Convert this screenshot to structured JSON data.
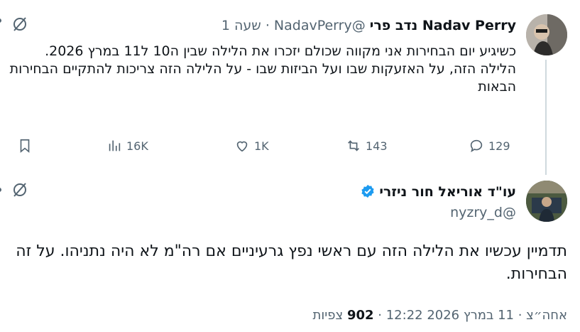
{
  "reply": {
    "display_name": "Nadav Perry נדב פרי",
    "handle": "@NadavPerry",
    "time": "שעה 1",
    "text": "כשיגיע יום הבחירות אני מקווה שכולם יזכרו את הלילה שבין ה10 ל11 במרץ 2026.\nהלילה הזה, על האזעקות שבו ועל הביזות שבו - על הלילה הזה צריכות להתקיים הבחירות הבאות",
    "stats": {
      "replies": "129",
      "retweets": "143",
      "likes": "1K",
      "views": "16K"
    }
  },
  "main": {
    "display_name": "עו\"ד אוריאל חור ניזרי",
    "handle": "@nyzry_d",
    "text": "תדמיין עכשיו את הלילה הזה עם ראשי נפץ גרעיניים אם רה\"מ לא היה נתניהו. על זה הבחירות.",
    "timestamp": "אחה״צ · 11 במרץ 2026 12:22",
    "views_count": "902",
    "views_label": "צפיות"
  },
  "icons": [
    "grok-icon",
    "verified-badge-icon",
    "reply-icon",
    "retweet-icon",
    "like-icon",
    "views-icon",
    "bookmark-icon",
    "more-icon"
  ],
  "colors": {
    "verified": "#1d9bf0",
    "muted": "#536471",
    "text": "#0f1419",
    "thread_line": "#cfd9de"
  }
}
